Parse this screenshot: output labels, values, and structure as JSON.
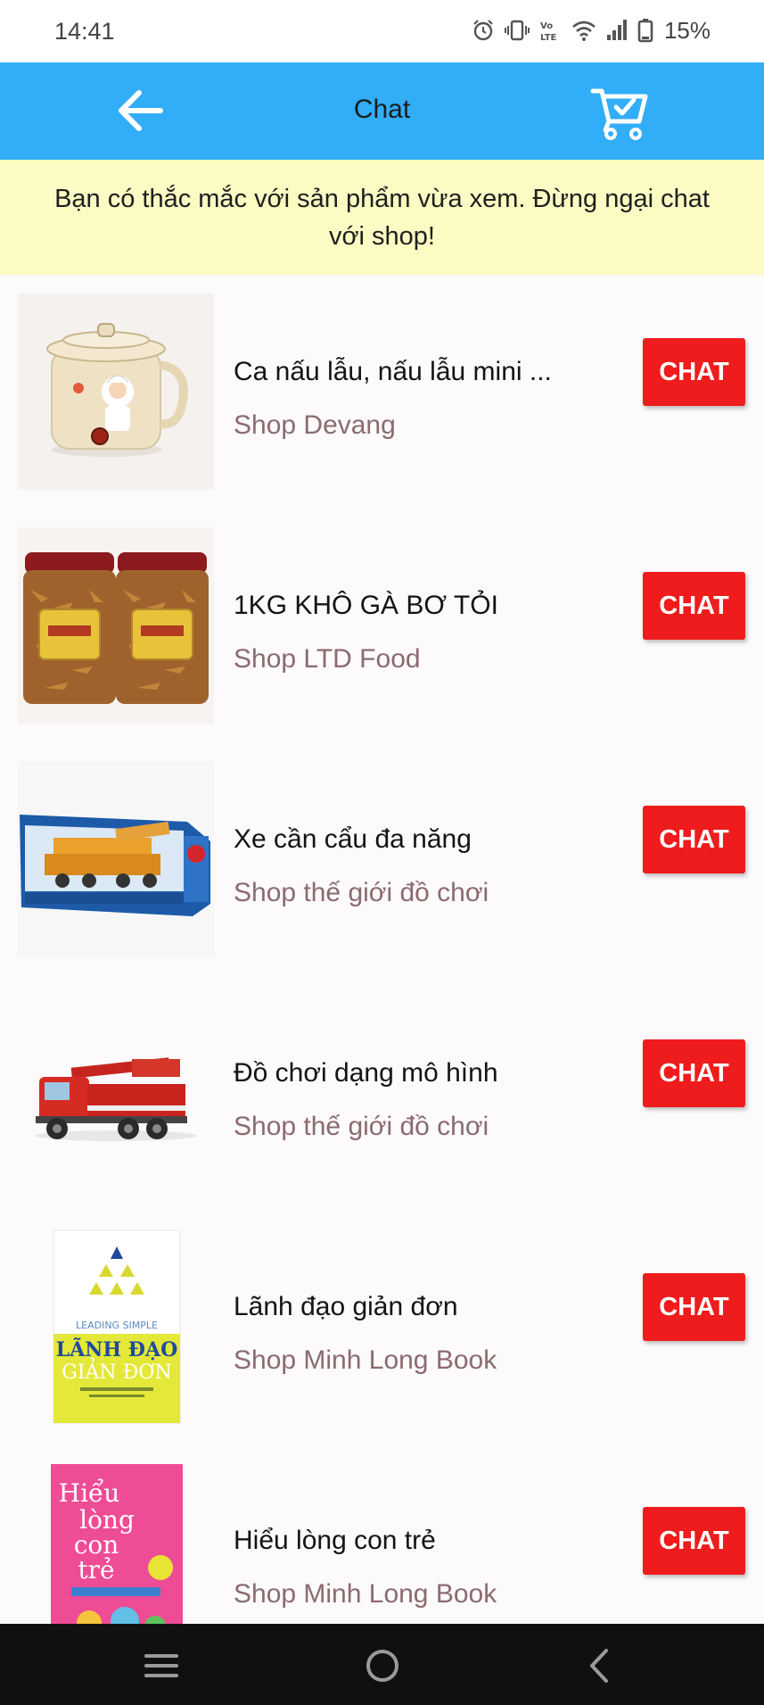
{
  "status_bar": {
    "time": "14:41",
    "battery_percent": "15%",
    "icons": [
      "alarm-icon",
      "vibrate-icon",
      "volte-icon",
      "wifi-icon",
      "signal-icon",
      "battery-icon"
    ]
  },
  "header": {
    "title": "Chat",
    "back_icon": "arrow-left-icon",
    "cart_icon": "cart-check-icon",
    "bg_color": "#32adf7"
  },
  "notice": {
    "text": "Bạn có thắc mắc với sản phẩm vừa xem. Đừng ngại chat với shop!",
    "bg_color": "#fbfbc3"
  },
  "products": [
    {
      "name": "Ca nấu lẫu, nấu lẫu mini ...",
      "shop": "Shop Devang",
      "chat_label": "CHAT",
      "image": "rice-cooker-image"
    },
    {
      "name": "1KG KHÔ GÀ BƠ TỎI",
      "shop": "Shop LTD Food",
      "chat_label": "CHAT",
      "image": "dried-chicken-jars-image"
    },
    {
      "name": "Xe cần cẩu đa năng",
      "shop": "Shop thế giới đồ chơi",
      "chat_label": "CHAT",
      "image": "crane-truck-box-image"
    },
    {
      "name": "Đồ chơi dạng mô hình",
      "shop": "Shop thế giới đồ chơi",
      "chat_label": "CHAT",
      "image": "fire-truck-toy-image"
    },
    {
      "name": "Lãnh đạo giản đơn",
      "shop": "Shop Minh Long Book",
      "chat_label": "CHAT",
      "image": "book-lanh-dao-image",
      "image_text": {
        "line1": "LEADING SIMPLE",
        "line2": "LÃNH ĐẠO",
        "line3": "GIẢN ĐƠN"
      }
    },
    {
      "name": "Hiểu lòng con trẻ",
      "shop": "Shop Minh Long Book",
      "chat_label": "CHAT",
      "image": "book-hieu-long-image",
      "image_text": {
        "line1": "Hiểu",
        "line2": "lòng",
        "line3": "con",
        "line4": "trẻ"
      }
    }
  ],
  "nav_bar": {
    "icons": [
      "menu-icon",
      "home-icon",
      "back-icon"
    ]
  },
  "colors": {
    "chat_button": "#ee1c1c",
    "shop_text": "#8b6b6f"
  }
}
